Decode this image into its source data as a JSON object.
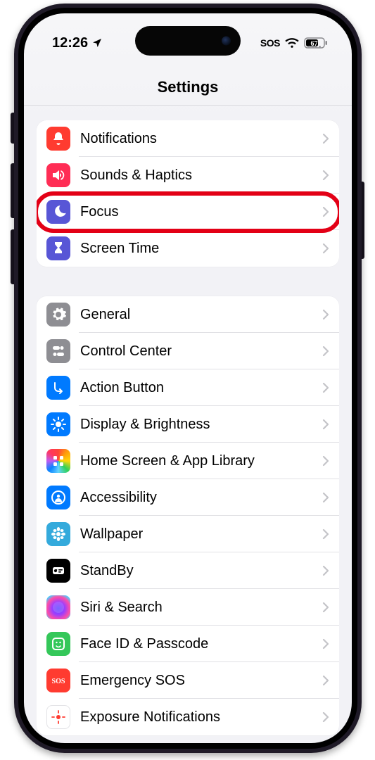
{
  "status": {
    "time": "12:26",
    "sos": "SOS",
    "battery": "67"
  },
  "title": "Settings",
  "highlight_id": "focus",
  "sectionA": [
    {
      "id": "notifications",
      "label": "Notifications",
      "icon": "bell",
      "color": "c-red"
    },
    {
      "id": "sounds",
      "label": "Sounds & Haptics",
      "icon": "speaker",
      "color": "c-pink"
    },
    {
      "id": "focus",
      "label": "Focus",
      "icon": "moon",
      "color": "c-indigo"
    },
    {
      "id": "screentime",
      "label": "Screen Time",
      "icon": "hourglass",
      "color": "c-indigo"
    }
  ],
  "sectionB": [
    {
      "id": "general",
      "label": "General",
      "icon": "gear",
      "color": "c-gray"
    },
    {
      "id": "controlcenter",
      "label": "Control Center",
      "icon": "switches",
      "color": "c-gray"
    },
    {
      "id": "actionbutton",
      "label": "Action Button",
      "icon": "action",
      "color": "c-blue"
    },
    {
      "id": "display",
      "label": "Display & Brightness",
      "icon": "sun",
      "color": "c-blue"
    },
    {
      "id": "homescreen",
      "label": "Home Screen & App Library",
      "icon": "grid",
      "color": "c-grad"
    },
    {
      "id": "accessibility",
      "label": "Accessibility",
      "icon": "person",
      "color": "c-blue"
    },
    {
      "id": "wallpaper",
      "label": "Wallpaper",
      "icon": "flower",
      "color": "c-lblue"
    },
    {
      "id": "standby",
      "label": "StandBy",
      "icon": "standby",
      "color": "c-black"
    },
    {
      "id": "siri",
      "label": "Siri & Search",
      "icon": "siri",
      "color": "c-siri"
    },
    {
      "id": "faceid",
      "label": "Face ID & Passcode",
      "icon": "face",
      "color": "c-green"
    },
    {
      "id": "sos",
      "label": "Emergency SOS",
      "icon": "sos",
      "color": "c-red"
    },
    {
      "id": "exposure",
      "label": "Exposure Notifications",
      "icon": "exposure",
      "color": "c-white"
    }
  ]
}
